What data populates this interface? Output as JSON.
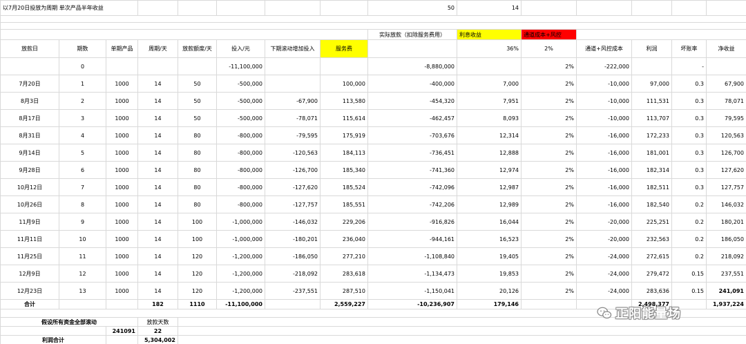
{
  "colors": {
    "yellow_fill": "#ffff00",
    "red_fill": "#ff0000",
    "gridline": "#d9d9d9"
  },
  "top": {
    "title": "以7月20日投放为周期 单次产品半年收益",
    "val_50": "50",
    "val_14": "14",
    "actual_loan_label": "实际放款（扣除服务费用）",
    "interest_label": "利息收益",
    "channel_label": "通道成本+风控"
  },
  "headers": {
    "date": "放款日",
    "period": "期数",
    "single_product": "单期产品",
    "cycle": "周期/天",
    "loan_quota": "放款额度/天",
    "invest": "投入/元",
    "rollover": "下期滚动增加投入",
    "service_fee": "服务费",
    "interest_rate": "36%",
    "channel_rate": "2%",
    "channel_risk": "通道+风控成本",
    "profit": "利润",
    "bad_debt": "坏账率",
    "net_profit": "净收益"
  },
  "row0": {
    "period": "0",
    "invest": "-11,100,000",
    "actual": "-8,880,000",
    "rate": "2%",
    "channel": "-222,000",
    "bad_debt": "-"
  },
  "rows": [
    {
      "date": "7月20日",
      "period": "1",
      "single": "1000",
      "cycle": "14",
      "quota": "50",
      "invest": "-500,000",
      "rollover": "",
      "fee": "100,000",
      "actual": "-400,000",
      "interest": "7,000",
      "rate": "2%",
      "channel": "-10,000",
      "profit": "97,000",
      "bad": "0.3",
      "net": "67,900"
    },
    {
      "date": "8月3日",
      "period": "2",
      "single": "1000",
      "cycle": "14",
      "quota": "50",
      "invest": "-500,000",
      "rollover": "-67,900",
      "fee": "113,580",
      "actual": "-454,320",
      "interest": "7,951",
      "rate": "2%",
      "channel": "-10,000",
      "profit": "111,531",
      "bad": "0.3",
      "net": "78,071"
    },
    {
      "date": "8月17日",
      "period": "3",
      "single": "1000",
      "cycle": "14",
      "quota": "50",
      "invest": "-500,000",
      "rollover": "-78,071",
      "fee": "115,614",
      "actual": "-462,457",
      "interest": "8,093",
      "rate": "2%",
      "channel": "-10,000",
      "profit": "113,707",
      "bad": "0.3",
      "net": "79,595"
    },
    {
      "date": "8月31日",
      "period": "4",
      "single": "1000",
      "cycle": "14",
      "quota": "80",
      "invest": "-800,000",
      "rollover": "-79,595",
      "fee": "175,919",
      "actual": "-703,676",
      "interest": "12,314",
      "rate": "2%",
      "channel": "-16,000",
      "profit": "172,233",
      "bad": "0.3",
      "net": "120,563"
    },
    {
      "date": "9月14日",
      "period": "5",
      "single": "1000",
      "cycle": "14",
      "quota": "80",
      "invest": "-800,000",
      "rollover": "-120,563",
      "fee": "184,113",
      "actual": "-736,451",
      "interest": "12,888",
      "rate": "2%",
      "channel": "-16,000",
      "profit": "181,001",
      "bad": "0.3",
      "net": "126,700"
    },
    {
      "date": "9月28日",
      "period": "6",
      "single": "1000",
      "cycle": "14",
      "quota": "80",
      "invest": "-800,000",
      "rollover": "-126,700",
      "fee": "185,340",
      "actual": "-741,360",
      "interest": "12,974",
      "rate": "2%",
      "channel": "-16,000",
      "profit": "182,314",
      "bad": "0.3",
      "net": "127,620"
    },
    {
      "date": "10月12日",
      "period": "7",
      "single": "1000",
      "cycle": "14",
      "quota": "80",
      "invest": "-800,000",
      "rollover": "-127,620",
      "fee": "185,524",
      "actual": "-742,096",
      "interest": "12,987",
      "rate": "2%",
      "channel": "-16,000",
      "profit": "182,511",
      "bad": "0.3",
      "net": "127,757"
    },
    {
      "date": "10月26日",
      "period": "8",
      "single": "1000",
      "cycle": "14",
      "quota": "80",
      "invest": "-800,000",
      "rollover": "-127,757",
      "fee": "185,551",
      "actual": "-742,206",
      "interest": "12,989",
      "rate": "2%",
      "channel": "-16,000",
      "profit": "182,540",
      "bad": "0.2",
      "net": "146,032"
    },
    {
      "date": "11月9日",
      "period": "9",
      "single": "1000",
      "cycle": "14",
      "quota": "100",
      "invest": "-1,000,000",
      "rollover": "-146,032",
      "fee": "229,206",
      "actual": "-916,826",
      "interest": "16,044",
      "rate": "2%",
      "channel": "-20,000",
      "profit": "225,251",
      "bad": "0.2",
      "net": "180,201"
    },
    {
      "date": "11月11日",
      "period": "10",
      "single": "1000",
      "cycle": "14",
      "quota": "100",
      "invest": "-1,000,000",
      "rollover": "-180,201",
      "fee": "236,040",
      "actual": "-944,161",
      "interest": "16,523",
      "rate": "2%",
      "channel": "-20,000",
      "profit": "232,563",
      "bad": "0.2",
      "net": "186,050"
    },
    {
      "date": "11月25日",
      "period": "11",
      "single": "1000",
      "cycle": "14",
      "quota": "120",
      "invest": "-1,200,000",
      "rollover": "-186,050",
      "fee": "277,210",
      "actual": "-1,108,840",
      "interest": "19,405",
      "rate": "2%",
      "channel": "-24,000",
      "profit": "272,615",
      "bad": "0.2",
      "net": "218,092"
    },
    {
      "date": "12月9日",
      "period": "12",
      "single": "1000",
      "cycle": "14",
      "quota": "120",
      "invest": "-1,200,000",
      "rollover": "-218,092",
      "fee": "283,618",
      "actual": "-1,134,473",
      "interest": "19,853",
      "rate": "2%",
      "channel": "-24,000",
      "profit": "279,472",
      "bad": "0.15",
      "net": "237,551"
    },
    {
      "date": "12月23日",
      "period": "13",
      "single": "1000",
      "cycle": "14",
      "quota": "120",
      "invest": "-1,200,000",
      "rollover": "-237,551",
      "fee": "287,510",
      "actual": "-1,150,041",
      "interest": "20,126",
      "rate": "2%",
      "channel": "-24,000",
      "profit": "283,636",
      "bad": "0.15",
      "net": "241,091"
    }
  ],
  "total": {
    "label": "合计",
    "cycle": "182",
    "quota": "1110",
    "invest": "-11,100,000",
    "fee": "2,559,227",
    "actual": "-10,236,907",
    "interest": "179,146",
    "profit": "2,498,377",
    "net": "1,937,224"
  },
  "bottom": {
    "assumption": "假设所有资金全部滚动",
    "loan_days_label": "放款天数",
    "val_241091": "241091",
    "val_22": "22",
    "profit_total_label": "利润合计",
    "profit_total": "5,304,002"
  },
  "watermark": {
    "text": "正阳能量场",
    "icon": "wechat-icon"
  }
}
